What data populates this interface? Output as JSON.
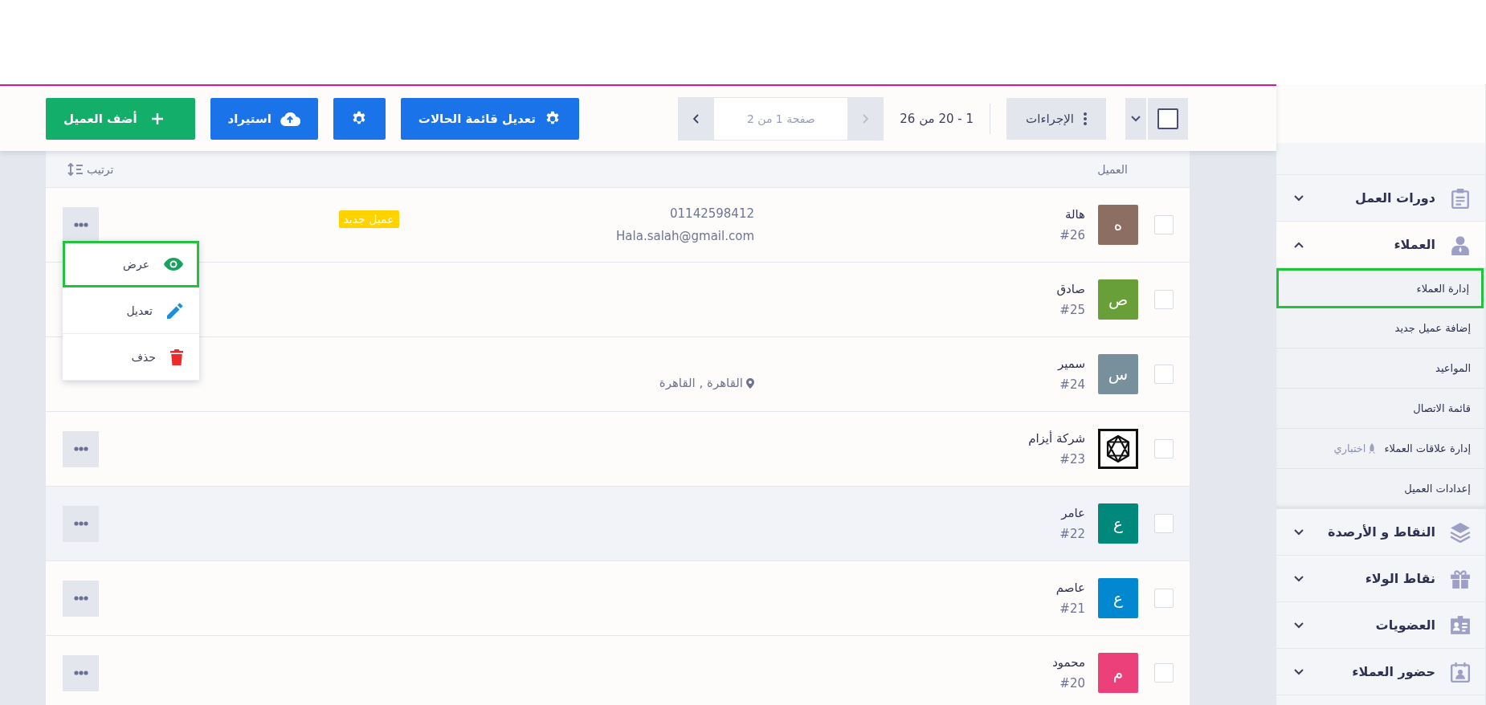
{
  "toolbar": {
    "select_all": {
      "checked": false
    },
    "actions_button": "الإجراءات",
    "range": "1 - 20 من 26",
    "pagination": {
      "placeholder": "صفحة 1 من 2",
      "prev_disabled": true,
      "next_disabled": false
    },
    "buttons": [
      {
        "kind": "settings",
        "label": "تعديل قائمة الحالات"
      },
      {
        "kind": "settings"
      },
      {
        "kind": "upload",
        "label": "استيراد"
      },
      {
        "kind": "add",
        "label": "أضف العميل"
      }
    ]
  },
  "table": {
    "columns": [
      "العميل"
    ],
    "sort": "ترتيب",
    "rows": [
      {
        "selected": false,
        "highlighted": false,
        "avatar": {
          "kind": "letter",
          "letter": "ه",
          "color": "#8d6e63"
        },
        "name": "هالة",
        "number": "#26",
        "phone": "01142598412",
        "email": "Hala.salah@gmail.com",
        "tag": "عميل جديد",
        "actions": true
      },
      {
        "selected": false,
        "highlighted": false,
        "avatar": {
          "kind": "letter",
          "letter": "ص",
          "color": "#689f38"
        },
        "name": "صادق",
        "number": "#25",
        "actions": false
      },
      {
        "selected": false,
        "highlighted": false,
        "avatar": {
          "kind": "letter",
          "letter": "س",
          "color": "#78909c"
        },
        "name": "سمير",
        "number": "#24",
        "location": "القاهرة , القاهرة",
        "actions": false
      },
      {
        "selected": false,
        "highlighted": false,
        "avatar": {
          "kind": "logo"
        },
        "name": "شركة أيزام",
        "number": "#23",
        "actions": true
      },
      {
        "selected": false,
        "highlighted": true,
        "avatar": {
          "kind": "letter",
          "letter": "ع",
          "color": "#00897b"
        },
        "name": "عامر",
        "number": "#22",
        "actions": true
      },
      {
        "selected": false,
        "highlighted": false,
        "avatar": {
          "kind": "letter",
          "letter": "ع",
          "color": "#0288d1"
        },
        "name": "عاصم",
        "number": "#21",
        "actions": true
      },
      {
        "selected": false,
        "highlighted": false,
        "avatar": {
          "kind": "letter",
          "letter": "م",
          "color": "#ec407a"
        },
        "name": "محمود",
        "number": "#20",
        "actions": true
      }
    ],
    "menu": [
      {
        "kind": "view",
        "label": "عرض",
        "selected": true
      },
      {
        "kind": "edit",
        "label": "تعديل",
        "selected": false
      },
      {
        "kind": "delete",
        "label": "حذف",
        "selected": false
      }
    ]
  },
  "sidebar": {
    "items": [
      {
        "kind": "clipboard",
        "label": "دورات العمل",
        "expanded": false
      },
      {
        "kind": "user",
        "label": "العملاء",
        "expanded": true,
        "children": [
          {
            "label": "إدارة العملاء",
            "selected": true
          },
          {
            "label": "إضافة عميل جديد",
            "selected": false
          },
          {
            "label": "المواعيد",
            "selected": false
          },
          {
            "label": "قائمة الاتصال",
            "selected": false
          },
          {
            "label": "إدارة علاقات العملاء",
            "badge": "اختباري",
            "selected": false
          },
          {
            "label": "إعدادات العميل",
            "selected": false
          }
        ]
      },
      {
        "kind": "layers",
        "label": "النقاط و الأرصدة",
        "expanded": false
      },
      {
        "kind": "gift",
        "label": "نقاط الولاء",
        "expanded": false
      },
      {
        "kind": "idcard",
        "label": "العضويات",
        "expanded": false
      },
      {
        "kind": "calendar",
        "label": "حضور العملاء",
        "expanded": false
      }
    ]
  }
}
